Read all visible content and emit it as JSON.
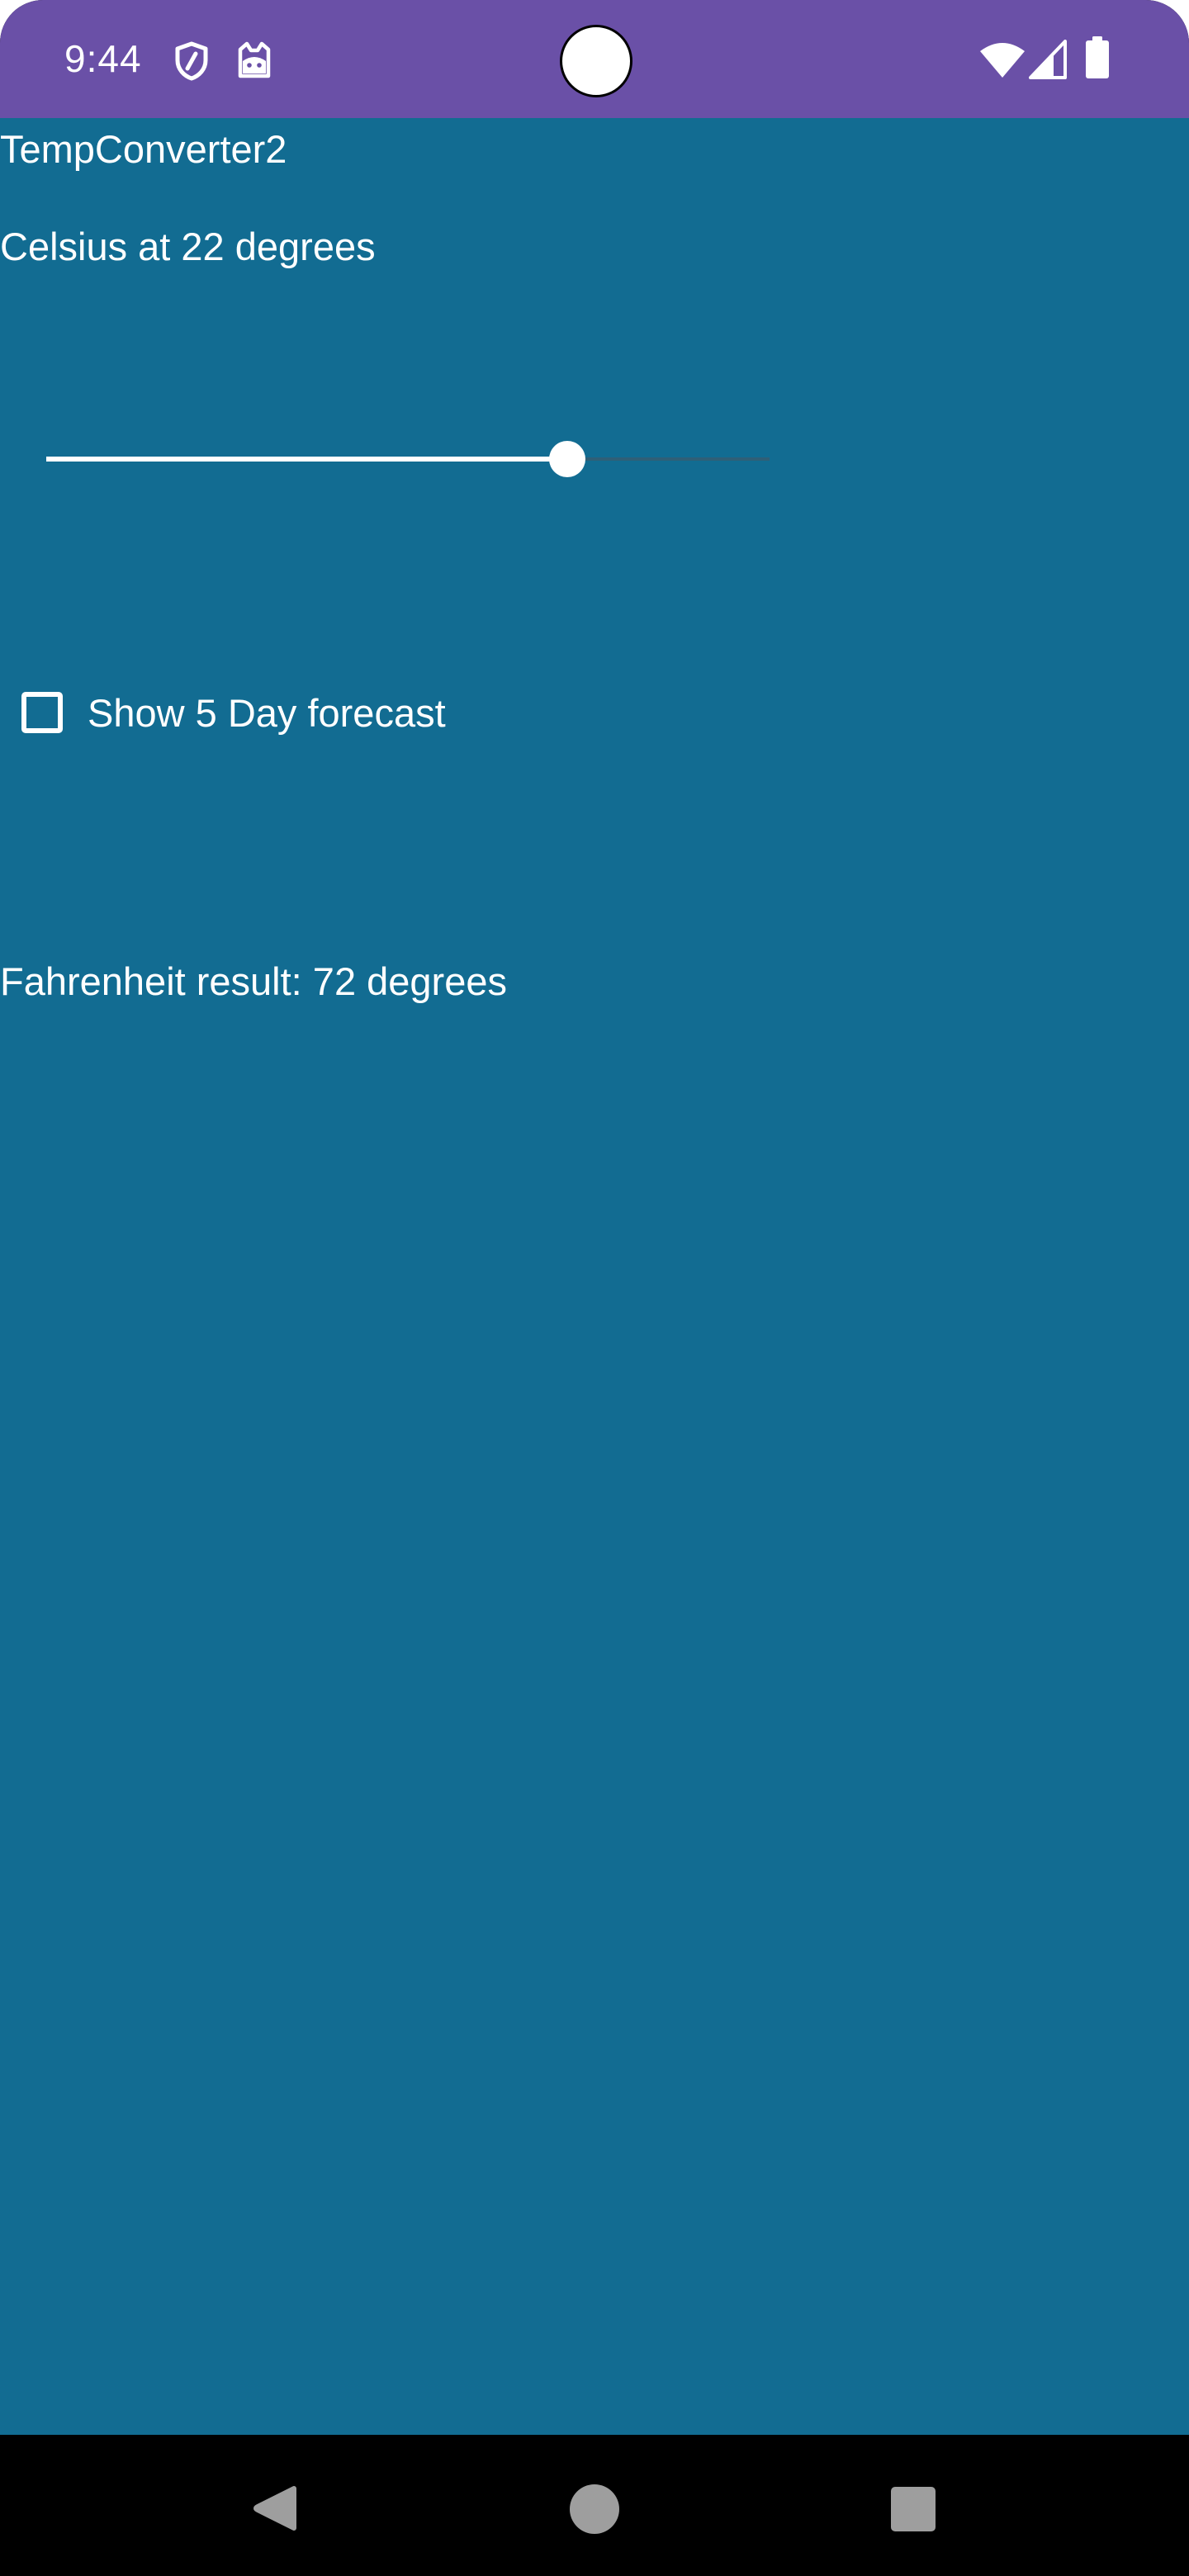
{
  "status_bar": {
    "time": "9:44",
    "background_color": "#6a50a7",
    "left_icons": [
      "shield-icon",
      "cat-face-icon"
    ],
    "right_icons": [
      "wifi-icon",
      "cellular-signal-icon",
      "battery-icon"
    ]
  },
  "app": {
    "background_color": "#126c92",
    "title": "TempConverter2",
    "celsius_label": "Celsius at 22 degrees",
    "celsius_slider": {
      "level": 0.72
    },
    "forecast_checkbox": {
      "label": "Show 5 Day forecast",
      "checked": false
    },
    "fahrenheit_label": "Fahrenheit result: 72 degrees"
  },
  "nav_bar": {
    "buttons": [
      "back-icon",
      "home-icon",
      "recents-icon"
    ]
  }
}
